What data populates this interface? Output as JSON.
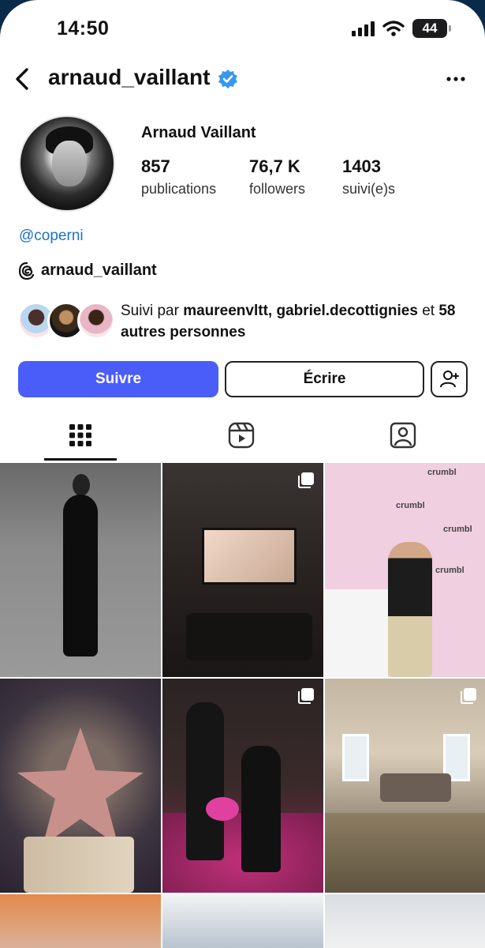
{
  "status": {
    "time": "14:50",
    "battery": "44"
  },
  "header": {
    "username": "arnaud_vaillant"
  },
  "profile": {
    "full_name": "Arnaud Vaillant",
    "stats": [
      {
        "value": "857",
        "label": "publications"
      },
      {
        "value": "76,7 K",
        "label": "followers"
      },
      {
        "value": "1403",
        "label": "suivi(e)s"
      }
    ],
    "link": "@coperni",
    "threads_handle": "arnaud_vaillant",
    "followed_by": {
      "prefix": "Suivi par ",
      "users": "maureenvltt, gabriel.decottignies",
      "middle": " et ",
      "others": "58 autres personnes"
    }
  },
  "actions": {
    "follow": "Suivre",
    "message": "Écrire"
  },
  "tabs": [
    {
      "name": "posts-grid",
      "icon": "grid-icon",
      "active": true
    },
    {
      "name": "reels",
      "icon": "reels-icon",
      "active": false
    },
    {
      "name": "tagged",
      "icon": "tagged-person-icon",
      "active": false
    }
  ],
  "colors": {
    "accent": "#4a5df9",
    "link": "#1d72c9",
    "verified": "#3897f0"
  }
}
